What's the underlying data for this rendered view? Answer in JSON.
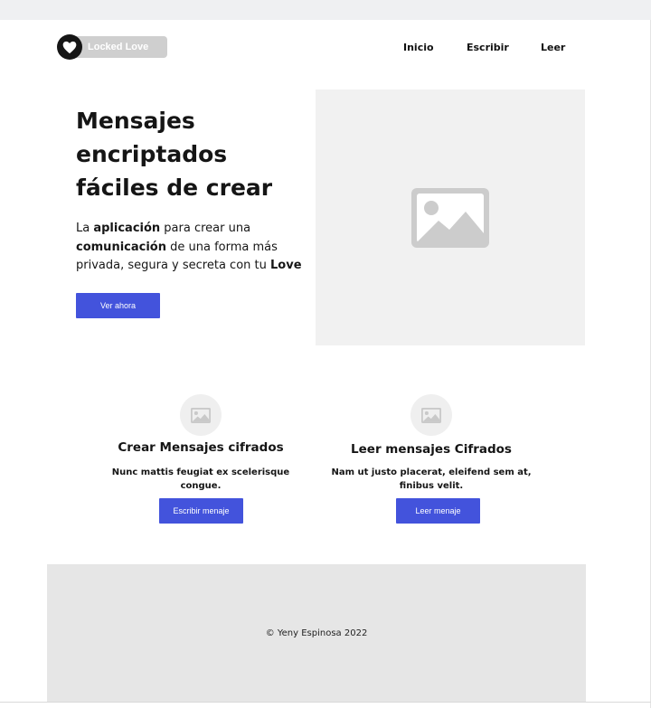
{
  "header": {
    "brand": "Locked Love",
    "nav": [
      "Inicio",
      "Escribir",
      "Leer"
    ]
  },
  "hero": {
    "title": "Mensajes encriptados fáciles de crear",
    "desc": {
      "p1": "La ",
      "b1": "aplicación",
      "p2": " para crear una ",
      "b2": "comunicación",
      "p3": " de una forma más privada,  segura y secreta con tu ",
      "b3": "Love"
    },
    "button": "Ver ahora"
  },
  "features": [
    {
      "title": "Crear Mensajes cifrados",
      "desc": "Nunc mattis feugiat ex scelerisque congue.",
      "button": "Escribir menaje"
    },
    {
      "title": "Leer mensajes Cifrados",
      "desc": "Nam ut justo placerat, eleifend sem at, finibus velit.",
      "button": "Leer menaje"
    }
  ],
  "footer": {
    "text": "© Yeny Espinosa 2022"
  },
  "icons": {
    "logo": "heart-icon",
    "image_placeholder": "image-placeholder-icon"
  },
  "colors": {
    "accent": "#4353dc",
    "placeholder_bg": "#f1f1f1",
    "footer_bg": "#e6e6e6"
  }
}
